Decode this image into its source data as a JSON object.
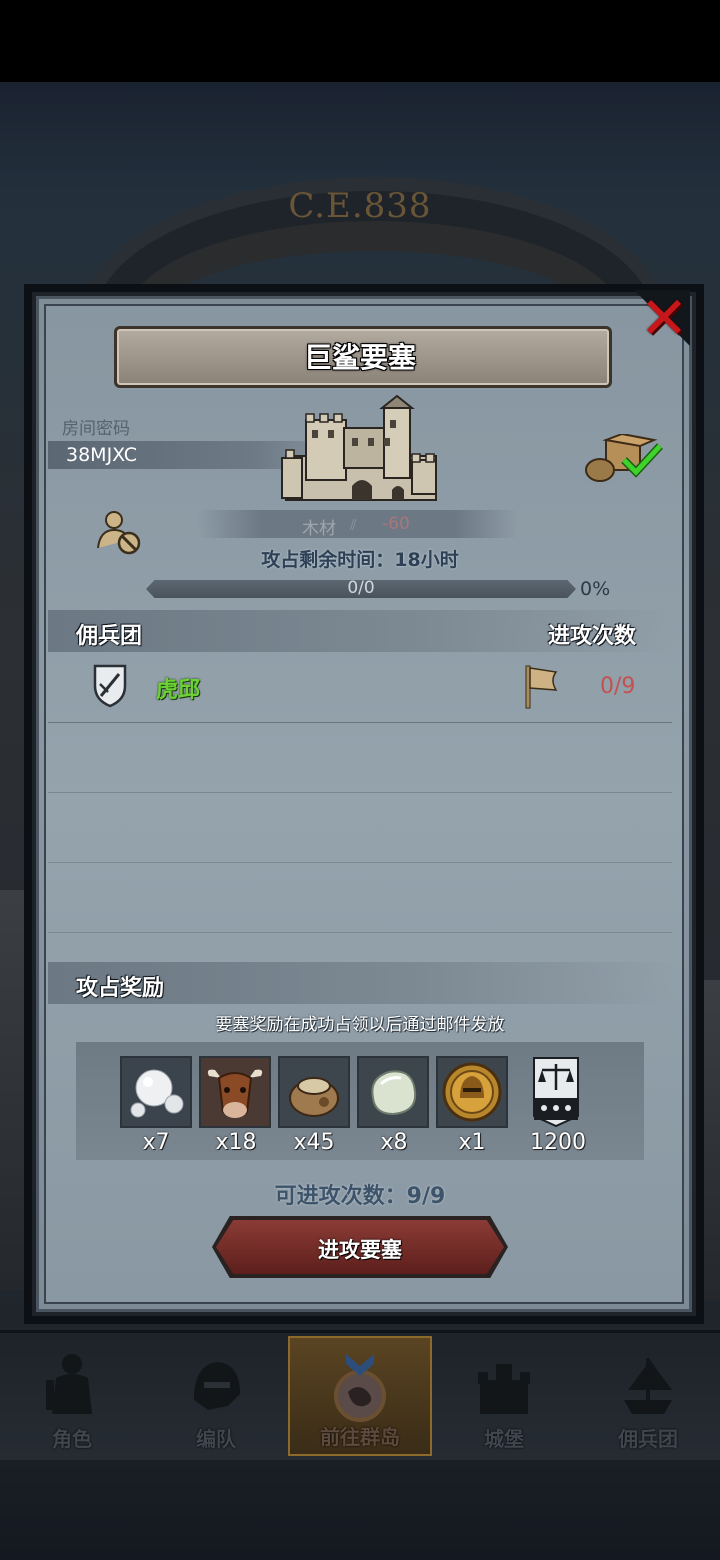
{
  "background": {
    "year": "C.E.838"
  },
  "dialog": {
    "title": "巨鲨要塞",
    "room_label": "房间密码",
    "room_code": "38MJXC",
    "resource": {
      "label": "木材",
      "value": "-60"
    },
    "time_remaining": "攻占剩余时间：18小时",
    "progress": {
      "text": "0/0",
      "percent_label": "0%",
      "fraction": 0
    },
    "mercenary_header": "佣兵团",
    "attack_count_header": "进攻次数",
    "mercenaries": [
      {
        "name": "虎邱",
        "attacks": "0/9"
      }
    ],
    "reward_header": "攻占奖励",
    "reward_note": "要塞奖励在成功占领以后通过邮件发放",
    "rewards": [
      {
        "icon": "pearl-icon",
        "qty": "x7"
      },
      {
        "icon": "ox-icon",
        "qty": "x18"
      },
      {
        "icon": "sack-icon",
        "qty": "x45"
      },
      {
        "icon": "stone-icon",
        "qty": "x8"
      },
      {
        "icon": "helmet-medal-icon",
        "qty": "x1"
      },
      {
        "icon": "scales-banner-icon",
        "qty": "1200"
      }
    ],
    "attempts_label": "可进攻次数：9/9",
    "attack_button": "进攻要塞"
  },
  "nav": {
    "items": [
      {
        "label": "角色",
        "icon": "knight-icon"
      },
      {
        "label": "编队",
        "icon": "helmet-icon"
      },
      {
        "label": "前往群岛",
        "icon": "islands-icon",
        "active": true
      },
      {
        "label": "城堡",
        "icon": "castle-icon"
      },
      {
        "label": "佣兵团",
        "icon": "ship-icon"
      }
    ]
  },
  "colors": {
    "accent_green": "#6bd135",
    "danger_red": "#c55050",
    "close_red": "#c8171b"
  }
}
